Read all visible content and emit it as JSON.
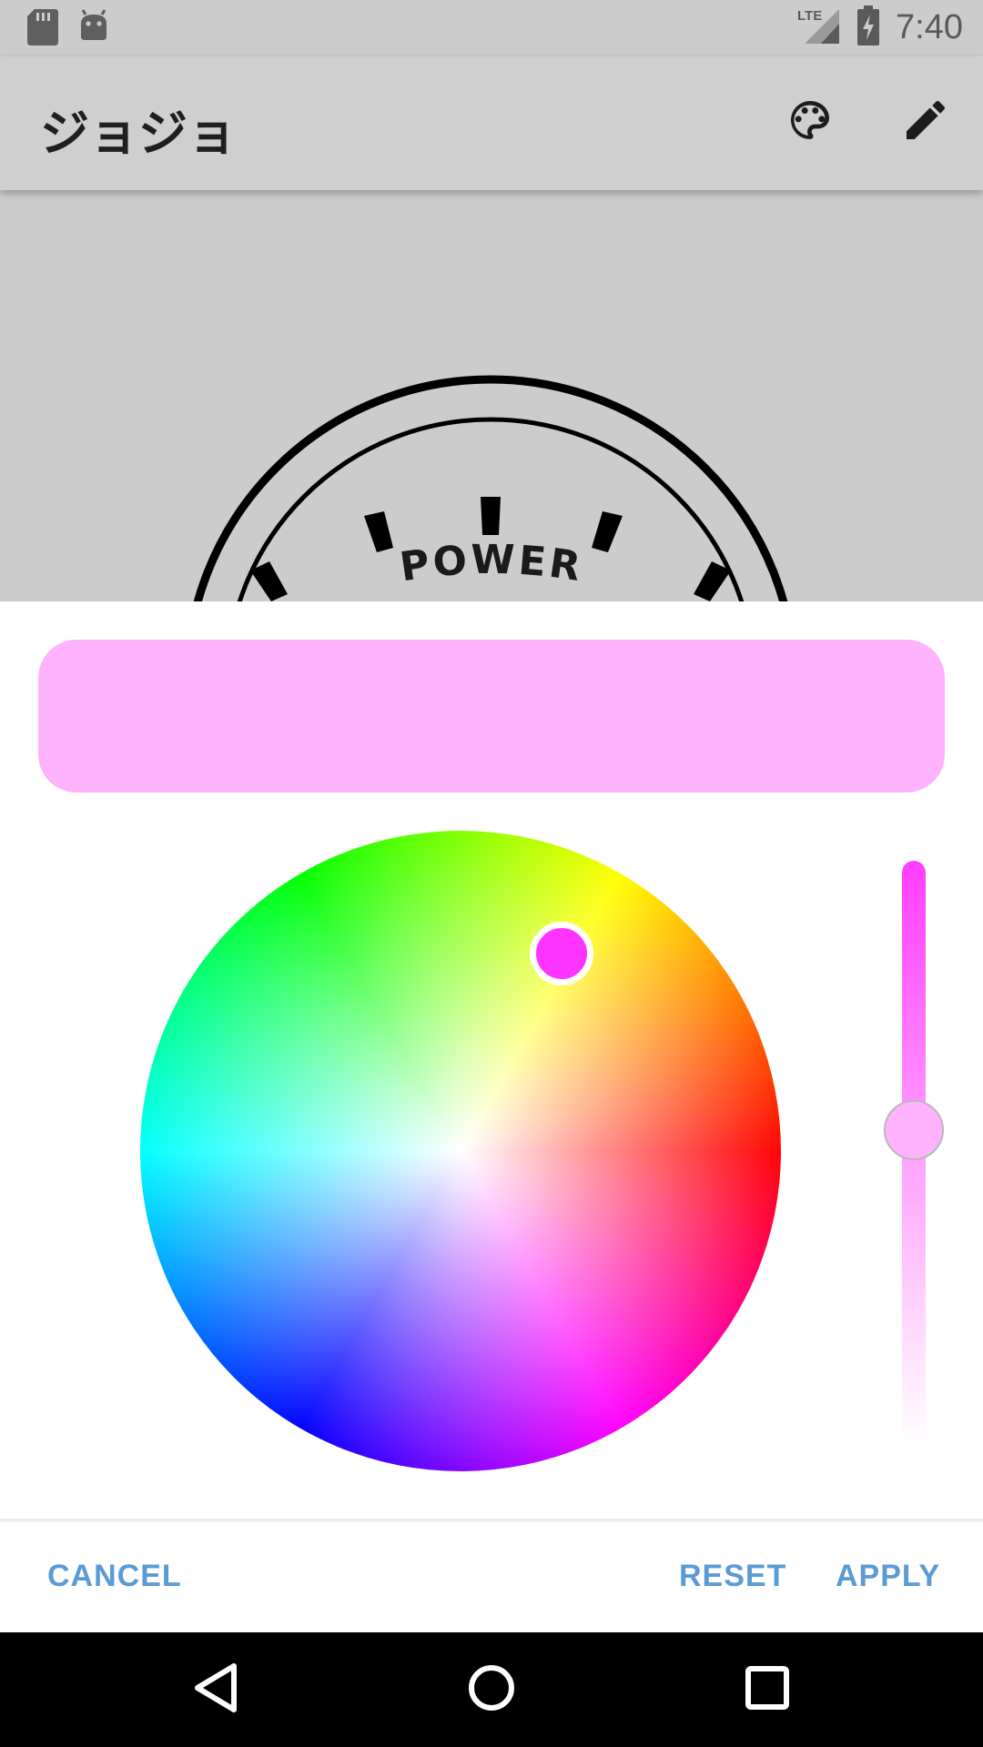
{
  "status_bar": {
    "time": "7:40",
    "network": "LTE",
    "left_icons": [
      "sd-card-icon",
      "android-debug-icon"
    ],
    "right_icons": [
      "signal-icon",
      "battery-charging-icon"
    ]
  },
  "app_bar": {
    "title": "ジョジョ",
    "actions": [
      "palette-icon",
      "edit-pencil-icon"
    ]
  },
  "background_content": {
    "dial_label": "POWER"
  },
  "color_picker": {
    "selected_color": "#ffb3fd",
    "wheel_handle_color": "#ff33ff",
    "brightness_level": 0.6,
    "slider_top_color": "#ff3dff",
    "buttons": {
      "cancel": "CANCEL",
      "reset": "RESET",
      "apply": "APPLY"
    }
  },
  "nav_bar": {
    "icons": [
      "back-icon",
      "home-icon",
      "recents-icon"
    ]
  },
  "colors": {
    "button_text": "#5b9bd5",
    "app_bar_bg": "#cfcfcf",
    "status_bar_bg": "#cccccc"
  }
}
